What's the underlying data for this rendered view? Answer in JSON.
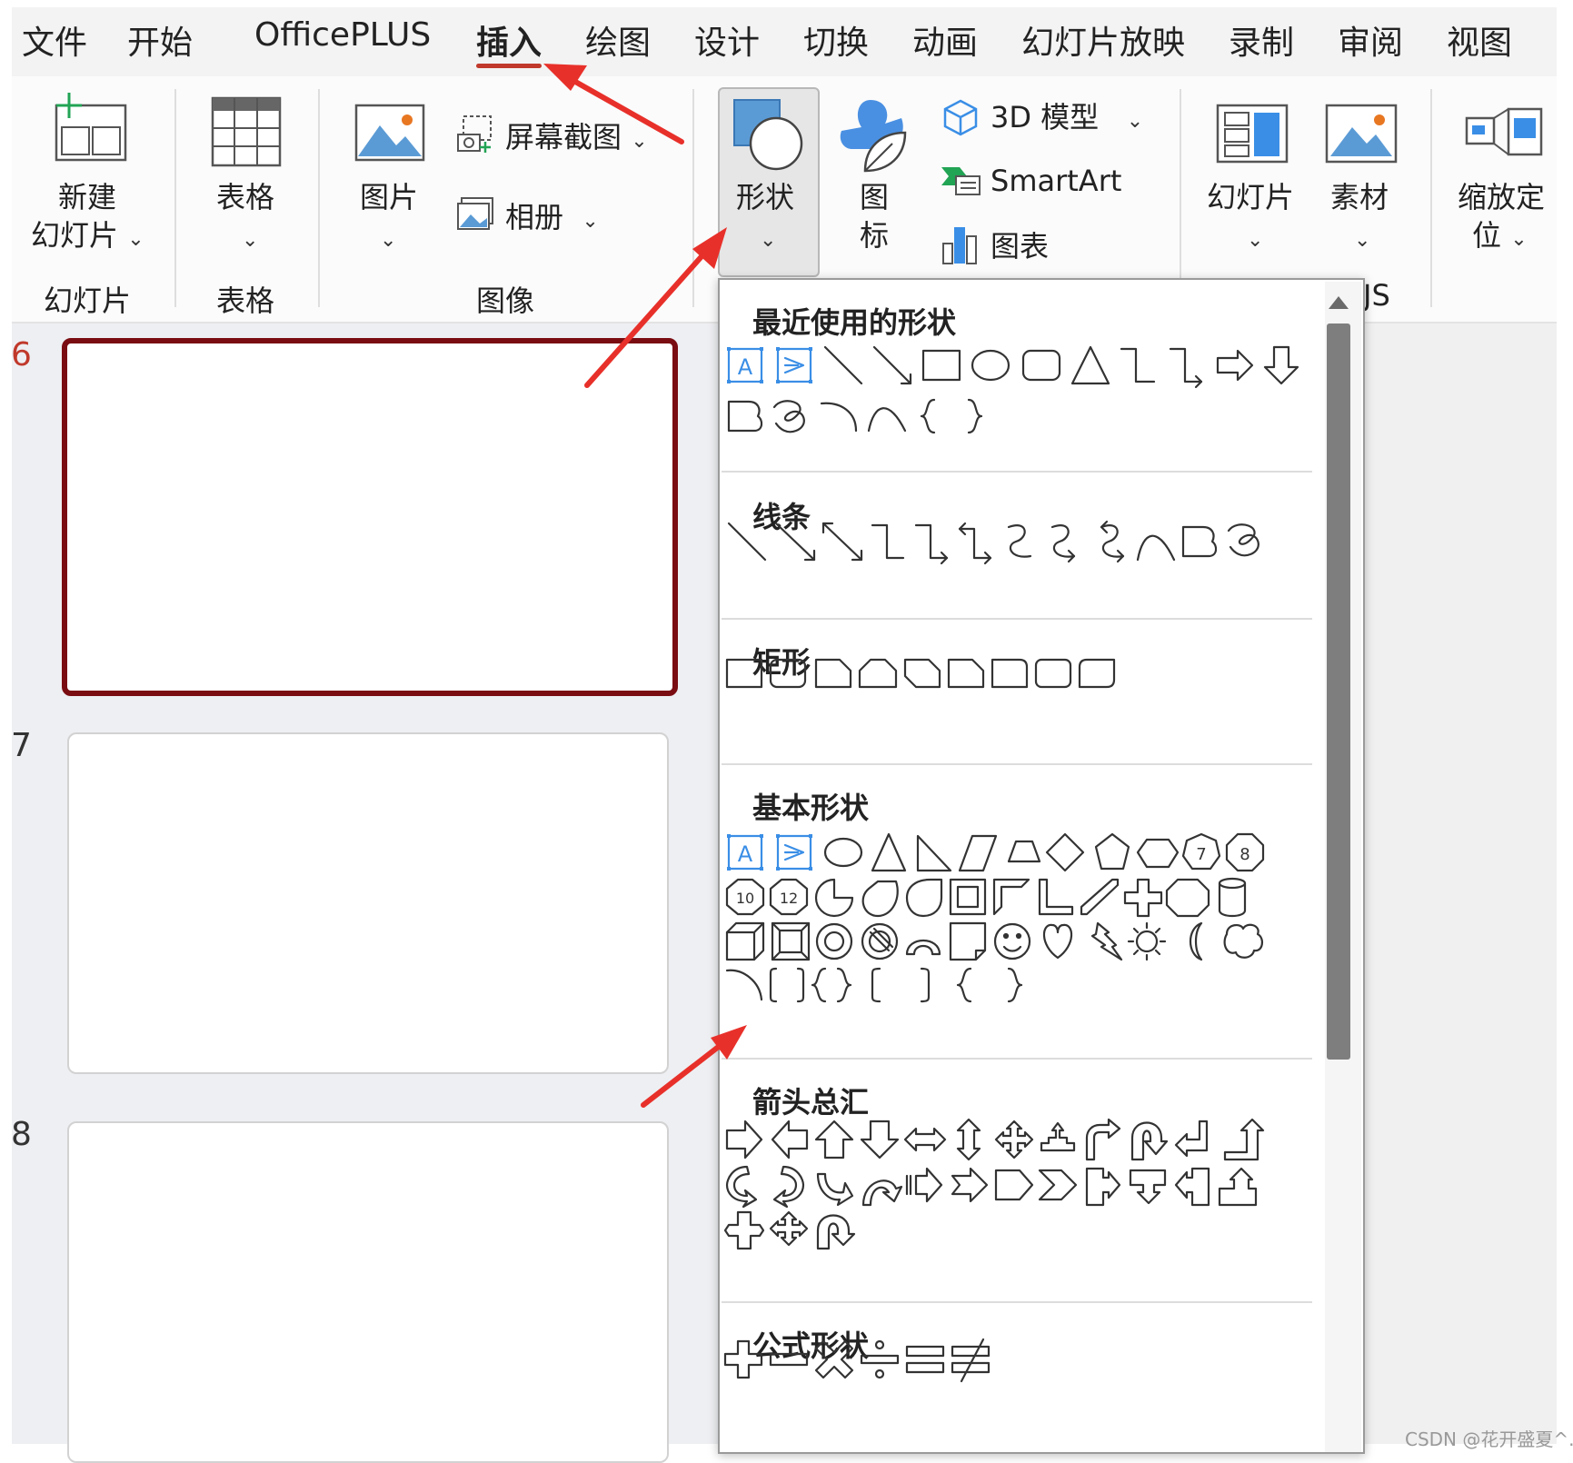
{
  "menu_tabs": [
    "文件",
    "开始",
    "OfficePLUS",
    "插入",
    "绘图",
    "设计",
    "切换",
    "动画",
    "幻灯片放映",
    "录制",
    "审阅",
    "视图"
  ],
  "active_tab": "插入",
  "ribbon": {
    "new_slide": {
      "line1": "新建",
      "line2": "幻灯片"
    },
    "table": "表格",
    "picture": "图片",
    "screenshot": "屏幕截图",
    "album": "相册",
    "shapes": "形状",
    "icons": {
      "line1": "图",
      "line2": "标"
    },
    "model_3d": "3D 模型",
    "smartart": "SmartArt",
    "chart": "图表",
    "slide_lib": "幻灯片",
    "material": "素材",
    "zoom": {
      "line1": "缩放定",
      "line2": "位"
    },
    "groups": {
      "slides": "幻灯片",
      "tables": "表格",
      "images": "图像",
      "partial": "JS"
    }
  },
  "slides": [
    {
      "number": "6"
    },
    {
      "number": "7"
    },
    {
      "number": "8"
    }
  ],
  "shapes_menu": {
    "sections": [
      "最近使用的形状",
      "线条",
      "矩形",
      "基本形状",
      "箭头总汇",
      "公式形状"
    ],
    "badges": {
      "b7": "7",
      "b8": "8",
      "b10": "10",
      "b12": "12",
      "textbox": "A"
    }
  },
  "colors": {
    "accent": "#c0392b",
    "selected_slide_border": "#7a0d12",
    "icon_blue": "#3a8ee6",
    "arrow_red": "#e8302a"
  },
  "watermark": "CSDN @花开盛夏^.^"
}
